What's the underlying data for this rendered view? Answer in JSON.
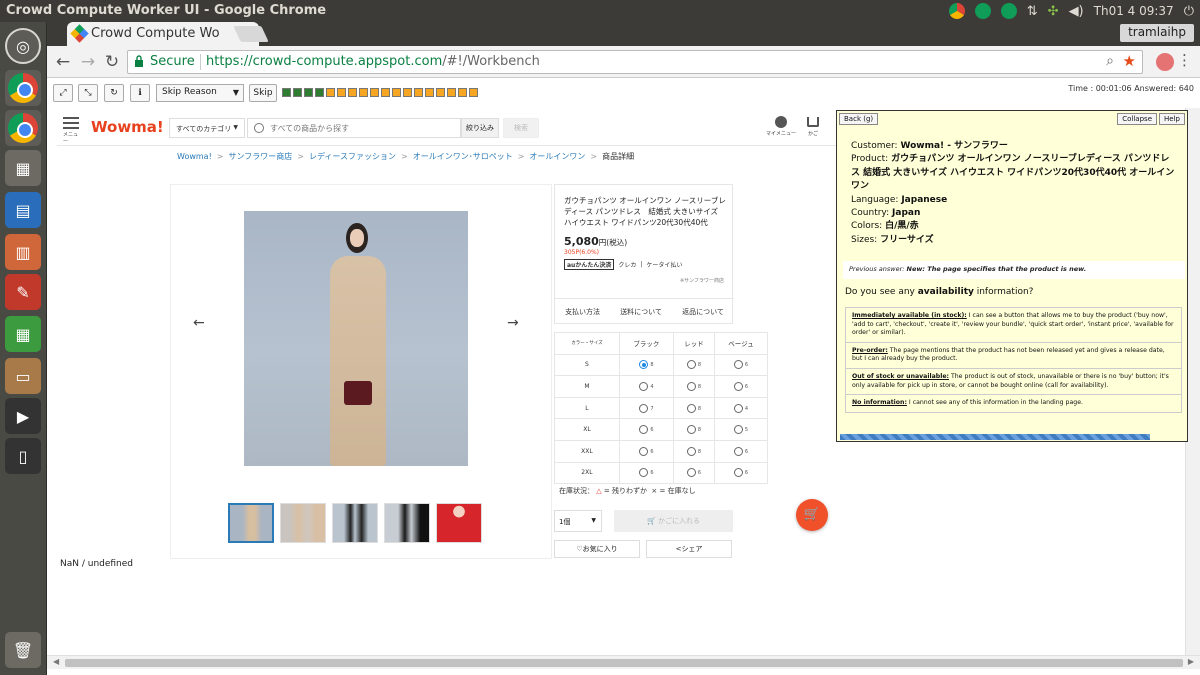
{
  "os": {
    "window_title": "Crowd Compute Worker UI - Google Chrome",
    "clock": "Th01 4 09:37"
  },
  "browser": {
    "tab_title": "Crowd Compute Wo",
    "user_chip": "tramlaihp",
    "secure_label": "Secure",
    "url_scheme_host": "https://crowd-compute.appspot.com",
    "url_path": "/#!/Workbench"
  },
  "worker_bar": {
    "skip_reason_placeholder": "Skip Reason",
    "skip_label": "Skip",
    "progress": [
      "done",
      "done",
      "done",
      "done",
      "pending",
      "pending",
      "pending",
      "pending",
      "pending",
      "pending",
      "pending",
      "pending",
      "pending",
      "pending",
      "pending",
      "pending",
      "pending",
      "pending"
    ],
    "colors": {
      "done": "#2e7d32",
      "pending": "#f6a623"
    },
    "time_label": "Time : 00:01:06 Answered: 640"
  },
  "store": {
    "menu_label": "メニュー",
    "logo": "Wowma!",
    "category_select": "すべてのカテゴリ",
    "search_placeholder": "すべての商品から探す",
    "narrow_button": "絞り込み",
    "search_button": "検索",
    "mymenu_label": "マイメニュー",
    "cart_label": "かご",
    "breadcrumbs": [
      "Wowma!",
      "サンフラワー商店",
      "レディースファッション",
      "オールインワン･サロペット",
      "オールインワン"
    ],
    "breadcrumb_current": "商品詳細",
    "product_title": "ガウチョパンツ オールインワン ノースリーブレディース パンツドレス　結婚式 大きいサイズ ハイウエスト ワイドパンツ20代30代40代",
    "price": "5,080",
    "price_unit": "円",
    "price_tax": "(税込)",
    "points": "305P(6.0%)",
    "pay_au": "auかんたん決済",
    "pay_card": "クレカ",
    "pay_mobile": "ケータイ払い",
    "shop_note": "※サンフラワー商店",
    "info_links": [
      "支払い方法",
      "送料について",
      "返品について"
    ],
    "color_size_header": "カラー・サイズ",
    "colors": [
      "ブラック",
      "レッド",
      "ベージュ"
    ],
    "sizes": [
      {
        "size": "S",
        "stock": [
          "8",
          "8",
          "6"
        ]
      },
      {
        "size": "M",
        "stock": [
          "4",
          "8",
          "6"
        ]
      },
      {
        "size": "L",
        "stock": [
          "7",
          "8",
          "4"
        ]
      },
      {
        "size": "XL",
        "stock": [
          "6",
          "8",
          "5"
        ]
      },
      {
        "size": "XXL",
        "stock": [
          "6",
          "8",
          "6"
        ]
      },
      {
        "size": "2XL",
        "stock": [
          "6",
          "6",
          "6"
        ]
      }
    ],
    "stock_legend_label": "在庫状況：",
    "stock_few": "= 残りわずか",
    "stock_none": "= 在庫なし",
    "qty": "1個",
    "add_to_cart": "かごに入れる",
    "favorite": "お気に入り",
    "share": "シェア"
  },
  "status_text": "NaN / undefined",
  "task": {
    "back_label": "Back (g)",
    "collapse_label": "Collapse",
    "help_label": "Help",
    "customer_label": "Customer:",
    "customer": "Wowma! - サンフラワー",
    "product_label": "Product:",
    "product": "ガウチョパンツ オールインワン ノースリーブレディース パンツドレス 結婚式 大きいサイズ ハイウエスト ワイドパンツ20代30代40代 オールインワン",
    "language_label": "Language:",
    "language": "Japanese",
    "country_label": "Country:",
    "country": "Japan",
    "colors_label": "Colors:",
    "colors": "白/黒/赤",
    "sizes_label": "Sizes:",
    "sizes": "フリーサイズ",
    "previous_answer_label": "Previous answer:",
    "previous_answer": "New: The page specifies that the product is new.",
    "question_pre": "Do you see any ",
    "question_bold": "availability",
    "question_post": " information?",
    "options": [
      {
        "title": "Immediately available (in stock):",
        "text": " I can see a button that allows me to buy the product ('buy now', 'add to cart', 'checkout', 'create it', 'review your bundle', 'quick start order', 'instant price', 'available for order' or similar)."
      },
      {
        "title": "Pre-order:",
        "text": " The page mentions that the product has not been released yet and gives a release date, but I can already buy the product."
      },
      {
        "title": "Out of stock or unavailable:",
        "text": " The product is out of stock, unavailable or there is no 'buy' button; it's only available for pick up in store, or cannot be bought online (call for availability)."
      },
      {
        "title": "No information:",
        "text": " I cannot see any of this information in the landing page."
      }
    ]
  }
}
